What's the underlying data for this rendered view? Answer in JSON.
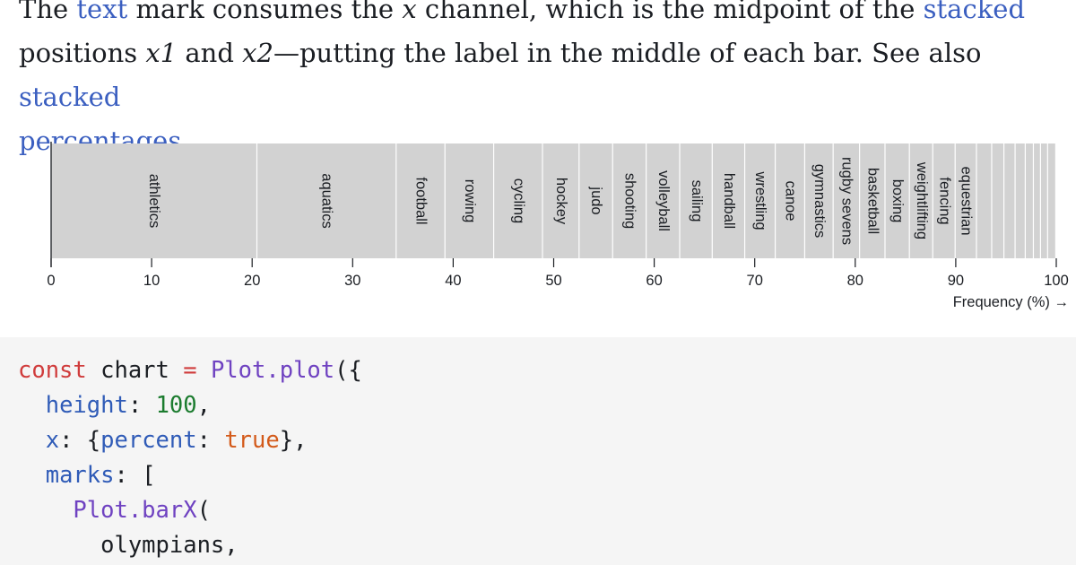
{
  "prose": {
    "line1_parts": [
      "The ",
      "text",
      " mark consumes the ",
      "x",
      " channel, which is the midpoint of the ",
      "stacked"
    ],
    "line2_parts": [
      "positions ",
      "x1",
      " and ",
      "x2",
      "—putting the label in the middle of each bar. See also ",
      "stacked"
    ],
    "line3_parts": [
      "percentages",
      "."
    ]
  },
  "chart_data": {
    "type": "bar",
    "orientation": "horizontal-stacked",
    "xlabel": "Frequency (%) →",
    "xlim": [
      0,
      100
    ],
    "ticks": [
      0,
      10,
      20,
      30,
      40,
      50,
      60,
      70,
      80,
      90,
      100
    ],
    "grid": false,
    "bar_color": "#d2d2d2",
    "categories": [
      "athletics",
      "aquatics",
      "football",
      "rowing",
      "cycling",
      "hockey",
      "judo",
      "shooting",
      "volleyball",
      "sailing",
      "handball",
      "wrestling",
      "canoe",
      "gymnastics",
      "rugby sevens",
      "basketball",
      "boxing",
      "weightlifting",
      "fencing",
      "equestrian",
      "",
      "",
      "",
      "",
      "",
      "",
      "",
      ""
    ],
    "values": [
      20.3,
      13.7,
      4.8,
      4.8,
      4.8,
      3.6,
      3.3,
      3.3,
      3.3,
      3.2,
      3.2,
      3.0,
      2.9,
      2.8,
      2.6,
      2.5,
      2.4,
      2.3,
      2.2,
      2.1,
      1.5,
      1.2,
      1.1,
      1.0,
      0.8,
      0.7,
      0.7,
      0.8
    ]
  },
  "code": {
    "lines": [
      [
        [
          "kw",
          "const"
        ],
        [
          "plain",
          " chart "
        ],
        [
          "kw",
          "="
        ],
        [
          "plain",
          " "
        ],
        [
          "fn",
          "Plot.plot"
        ],
        [
          "plain",
          "({"
        ]
      ],
      [
        [
          "plain",
          "  "
        ],
        [
          "prop",
          "height"
        ],
        [
          "plain",
          ": "
        ],
        [
          "num",
          "100"
        ],
        [
          "plain",
          ","
        ]
      ],
      [
        [
          "plain",
          "  "
        ],
        [
          "prop",
          "x"
        ],
        [
          "plain",
          ": {"
        ],
        [
          "prop",
          "percent"
        ],
        [
          "plain",
          ": "
        ],
        [
          "bool",
          "true"
        ],
        [
          "plain",
          "},"
        ]
      ],
      [
        [
          "plain",
          "  "
        ],
        [
          "prop",
          "marks"
        ],
        [
          "plain",
          ": ["
        ]
      ],
      [
        [
          "plain",
          "    "
        ],
        [
          "fn",
          "Plot.barX"
        ],
        [
          "plain",
          "("
        ]
      ],
      [
        [
          "plain",
          "      olympians,"
        ]
      ]
    ]
  }
}
